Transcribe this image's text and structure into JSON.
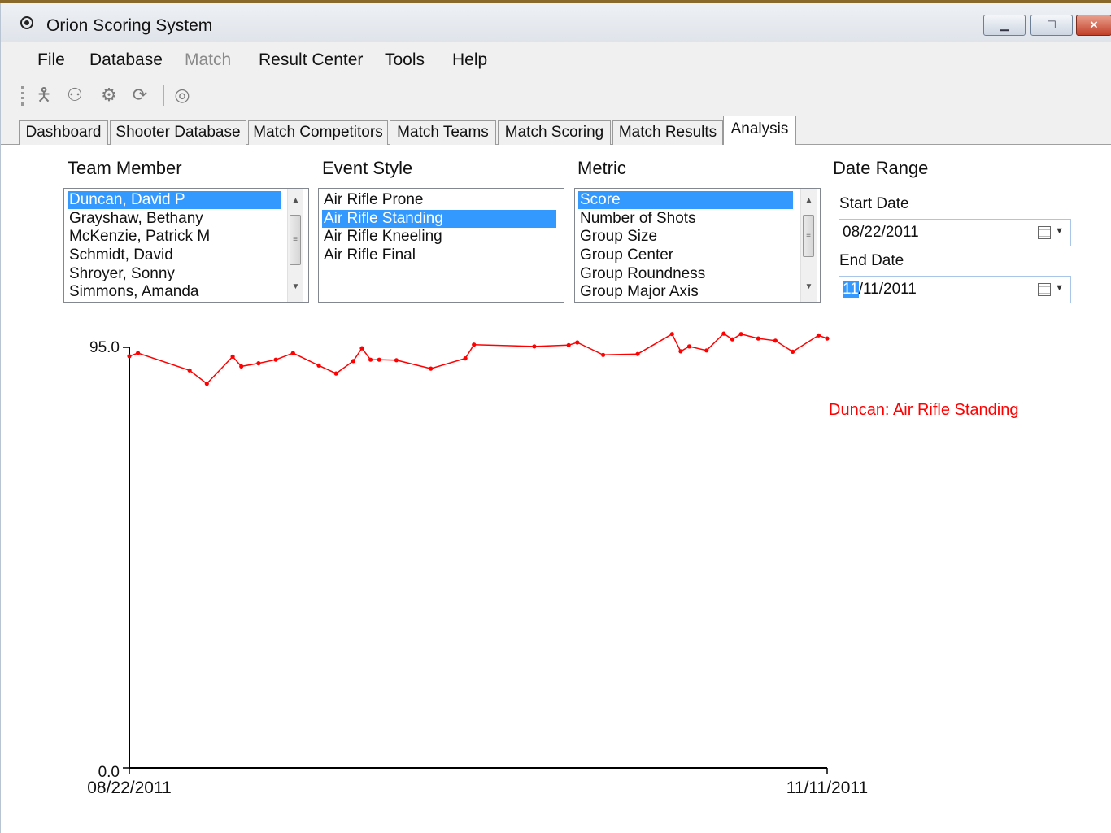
{
  "window": {
    "title": "Orion Scoring System",
    "minimize_icon": "minimize-icon",
    "maximize_icon": "maximize-icon",
    "close_icon": "close-icon"
  },
  "menu": [
    "File",
    "Database",
    "Match",
    "Result Center",
    "Tools",
    "Help"
  ],
  "menu_disabled": [
    "Match"
  ],
  "toolbar_icons": [
    "shooter-icon",
    "shooters-icon",
    "target-gear-icon",
    "target-refresh-icon",
    "target-rings-icon"
  ],
  "tabs": [
    "Dashboard",
    "Shooter Database",
    "Match Competitors",
    "Match Teams",
    "Match Scoring",
    "Match Results",
    "Analysis"
  ],
  "active_tab": "Analysis",
  "team_member": {
    "label": "Team Member",
    "items": [
      "Duncan, David P",
      "Grayshaw, Bethany",
      "McKenzie, Patrick M",
      "Schmidt, David",
      "Shroyer, Sonny",
      "Simmons, Amanda"
    ],
    "selected": "Duncan, David P"
  },
  "event_style": {
    "label": "Event Style",
    "items": [
      "Air Rifle Prone",
      "Air Rifle Standing",
      "Air Rifle Kneeling",
      "Air Rifle Final"
    ],
    "selected": "Air Rifle Standing"
  },
  "metric": {
    "label": "Metric",
    "items": [
      "Score",
      "Number of Shots",
      "Group Size",
      "Group Center",
      "Group Roundness",
      "Group Major Axis"
    ],
    "selected": "Score"
  },
  "date_range": {
    "label": "Date Range",
    "start_label": "Start Date",
    "start_value": "08/22/2011",
    "end_label": "End Date",
    "end_value_selected": "11",
    "end_value_rest": "/11/2011"
  },
  "chart_data": {
    "type": "line",
    "series": [
      {
        "name": "Duncan: Air Rifle Standing",
        "color": "#ff0000",
        "x": [
          "2011-08-22",
          "2011-08-23",
          "2011-08-29",
          "2011-08-31",
          "2011-09-03",
          "2011-09-04",
          "2011-09-06",
          "2011-09-08",
          "2011-09-10",
          "2011-09-13",
          "2011-09-15",
          "2011-09-17",
          "2011-09-18",
          "2011-09-19",
          "2011-09-20",
          "2011-09-22",
          "2011-09-26",
          "2011-09-30",
          "2011-10-01",
          "2011-10-08",
          "2011-10-12",
          "2011-10-13",
          "2011-10-16",
          "2011-10-20",
          "2011-10-24",
          "2011-10-25",
          "2011-10-26",
          "2011-10-28",
          "2011-10-30",
          "2011-10-31",
          "2011-11-01",
          "2011-11-03",
          "2011-11-05",
          "2011-11-07",
          "2011-11-10",
          "2011-11-11"
        ],
        "values": [
          93.0,
          93.7,
          89.8,
          86.8,
          92.9,
          90.7,
          91.4,
          92.2,
          93.7,
          90.9,
          89.1,
          91.9,
          94.8,
          92.2,
          92.2,
          92.1,
          90.2,
          92.5,
          95.6,
          95.2,
          95.5,
          96.1,
          93.3,
          93.5,
          98.0,
          94.1,
          95.2,
          94.3,
          98.1,
          96.8,
          98.0,
          97.0,
          96.5,
          94.0,
          97.7,
          97.0
        ]
      }
    ],
    "ylim": [
      0.0,
      95.0
    ],
    "y_tick_labels": [
      "95.0",
      "0.0"
    ],
    "x_tick_labels": [
      "08/22/2011",
      "11/11/2011"
    ],
    "xlim": [
      "2011-08-22",
      "2011-11-11"
    ],
    "legend": "right",
    "grid": false
  }
}
